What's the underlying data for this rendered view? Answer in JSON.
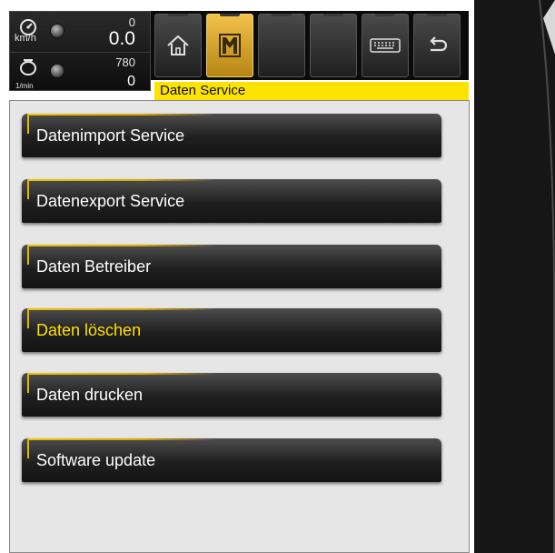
{
  "status": {
    "speed_unit": "km/h",
    "speed_sub": "0",
    "speed_value": "0.0",
    "rpm_unit": "1/min",
    "rpm_sub": "780",
    "rpm_value": "0"
  },
  "toolbar": {
    "buttons": [
      {
        "icon": "home-icon"
      },
      {
        "icon": "machine-menu-icon"
      },
      {
        "icon": "empty"
      },
      {
        "icon": "empty"
      },
      {
        "icon": "keyboard-icon"
      },
      {
        "icon": "back-arrow-icon"
      }
    ],
    "active_index": 1
  },
  "breadcrumb": "Daten Service",
  "menu": {
    "items": [
      {
        "label": "Datenimport Service"
      },
      {
        "label": "Datenexport Service"
      },
      {
        "label": "Daten Betreiber"
      },
      {
        "label": "Daten löschen"
      },
      {
        "label": "Daten drucken"
      },
      {
        "label": "Software update"
      }
    ],
    "selected_index": 3
  },
  "colors": {
    "accent_yellow": "#ffe300",
    "selected_text": "#ffe000",
    "button_dark": "#1f1f1f",
    "panel_bg": "#e6e6e6"
  }
}
